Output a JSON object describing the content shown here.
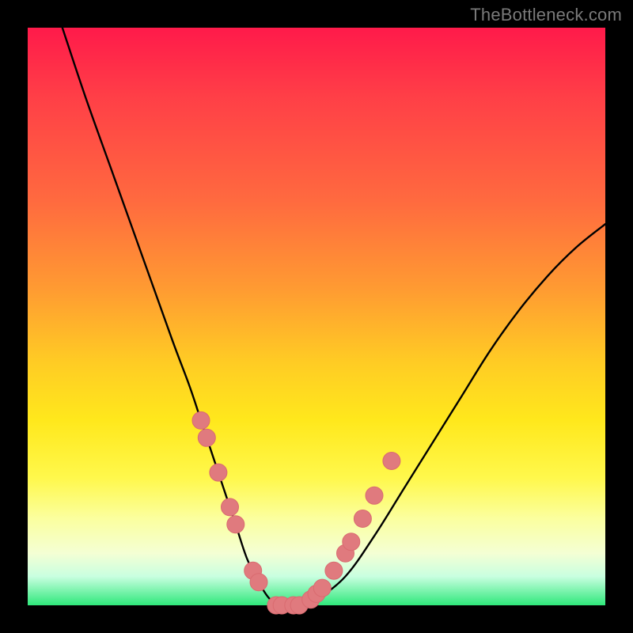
{
  "watermark": "TheBottleneck.com",
  "colors": {
    "frame": "#000000",
    "curve": "#000000",
    "marker_fill": "#e07a7e",
    "marker_stroke": "#d96b70",
    "gradient_stops": [
      "#ff1a4a",
      "#ff3f47",
      "#ff6a3f",
      "#ff9a32",
      "#ffcc24",
      "#ffe81c",
      "#fff84c",
      "#fbff9f",
      "#f4ffd4",
      "#c9ffe0",
      "#2fe87b"
    ]
  },
  "chart_data": {
    "type": "line",
    "title": "",
    "xlabel": "",
    "ylabel": "",
    "xlim": [
      0,
      100
    ],
    "ylim": [
      0,
      100
    ],
    "series": [
      {
        "name": "bottleneck-curve",
        "x": [
          6,
          10,
          15,
          20,
          25,
          28,
          30,
          32,
          34,
          36,
          38,
          40,
          42,
          44,
          46,
          48,
          50,
          55,
          60,
          65,
          70,
          75,
          80,
          85,
          90,
          95,
          100
        ],
        "y": [
          100,
          88,
          74,
          60,
          46,
          38,
          32,
          26,
          20,
          14,
          8,
          4,
          1,
          0,
          0,
          0,
          1,
          5,
          12,
          20,
          28,
          36,
          44,
          51,
          57,
          62,
          66
        ]
      }
    ],
    "markers": {
      "name": "highlighted-points",
      "x": [
        30,
        31,
        33,
        35,
        36,
        39,
        40,
        43,
        44,
        46,
        47,
        49,
        50,
        51,
        53,
        55,
        56,
        58,
        60,
        63
      ],
      "y": [
        32,
        29,
        23,
        17,
        14,
        6,
        4,
        0,
        0,
        0,
        0,
        1,
        2,
        3,
        6,
        9,
        11,
        15,
        19,
        25
      ]
    }
  }
}
